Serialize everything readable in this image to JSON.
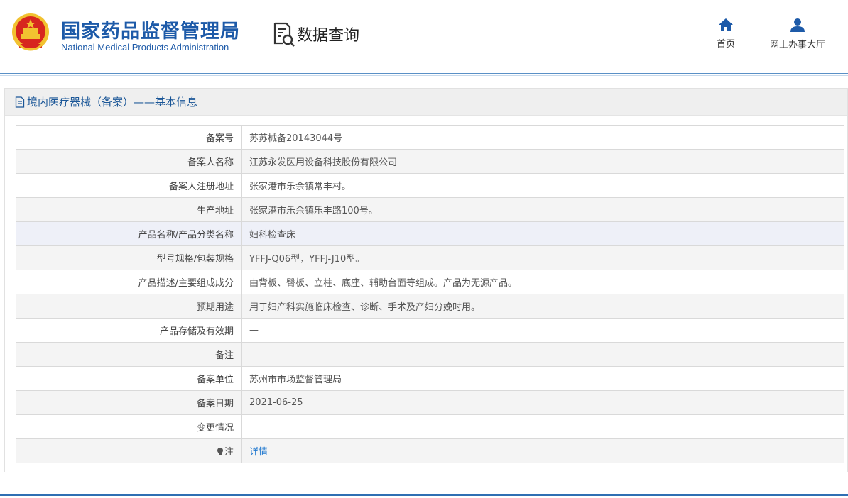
{
  "header": {
    "org_name_cn": "国家药品监督管理局",
    "org_name_en": "National Medical Products Administration",
    "data_query_label": "数据查询",
    "nav": [
      {
        "label": "首页",
        "icon": "home-icon"
      },
      {
        "label": "网上办事大厅",
        "icon": "user-icon"
      }
    ]
  },
  "panel": {
    "title": "境内医疗器械（备案）——基本信息",
    "rows": [
      {
        "label": "备案号",
        "value": "苏苏械备20143044号"
      },
      {
        "label": "备案人名称",
        "value": "江苏永发医用设备科技股份有限公司"
      },
      {
        "label": "备案人注册地址",
        "value": "张家港市乐余镇常丰村。"
      },
      {
        "label": "生产地址",
        "value": "张家港市乐余镇乐丰路100号。"
      },
      {
        "label": "产品名称/产品分类名称",
        "value": "妇科检查床"
      },
      {
        "label": "型号规格/包装规格",
        "value": "YFFJ-Q06型，YFFJ-J10型。"
      },
      {
        "label": "产品描述/主要组成成分",
        "value": "由背板、臀板、立柱、底座、辅助台面等组成。产品为无源产品。"
      },
      {
        "label": "预期用途",
        "value": "用于妇产科实施临床检查、诊断、手术及产妇分娩时用。"
      },
      {
        "label": "产品存储及有效期",
        "value": "—"
      },
      {
        "label": "备注",
        "value": ""
      },
      {
        "label": "备案单位",
        "value": "苏州市市场监督管理局"
      },
      {
        "label": "备案日期",
        "value": "2021-06-25"
      },
      {
        "label": "变更情况",
        "value": ""
      },
      {
        "label": "注",
        "value": "详情"
      }
    ]
  },
  "colors": {
    "brand_blue": "#1d5aa8",
    "link_blue": "#1e77cf",
    "title_blue": "#1a5697",
    "emblem_red": "#d7261e",
    "emblem_gold": "#f2c230"
  }
}
